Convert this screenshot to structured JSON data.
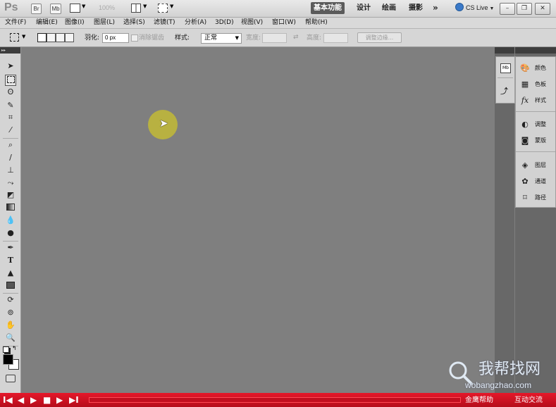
{
  "app": {
    "logo": "Ps",
    "bridge_label": "Br",
    "minibridge_label": "Mb",
    "zoom": "100%",
    "workspaces": [
      "基本功能",
      "设计",
      "绘画",
      "摄影"
    ],
    "more": "»",
    "cslive": "CS Live"
  },
  "menu": [
    "文件(F)",
    "编辑(E)",
    "图像(I)",
    "图层(L)",
    "选择(S)",
    "滤镜(T)",
    "分析(A)",
    "3D(D)",
    "视图(V)",
    "窗口(W)",
    "帮助(H)"
  ],
  "options": {
    "feather_label": "羽化:",
    "feather_value": "0 px",
    "antialias_label": "消除锯齿",
    "style_label": "样式:",
    "style_value": "正常",
    "width_label": "宽度:",
    "height_label": "高度:",
    "refine_button": "调整边缘..."
  },
  "tools": [
    "move",
    "marquee",
    "lasso",
    "quick-select",
    "crop",
    "eyedropper",
    "spot-heal",
    "brush",
    "clone-stamp",
    "history-brush",
    "eraser",
    "gradient",
    "blur",
    "dodge",
    "pen",
    "type",
    "path-select",
    "shape",
    "3d-rotate",
    "3d-orbit",
    "hand",
    "zoom"
  ],
  "tool_glyphs": {
    "type": "T"
  },
  "panels": {
    "group1": [
      "颜色",
      "色板",
      "样式"
    ],
    "group2": [
      "调整",
      "蒙版"
    ],
    "group3": [
      "图层",
      "通道",
      "路径"
    ]
  },
  "watermark": {
    "text": "我帮找网",
    "url": "wobangzhao.com"
  },
  "bottom": {
    "left_text": "金鹰帮助",
    "right_text": "互动交流"
  },
  "colors": {
    "canvas": "#7f7f7f",
    "bottombar": "#d0121f",
    "cursor_highlight": "#bdb53c"
  }
}
